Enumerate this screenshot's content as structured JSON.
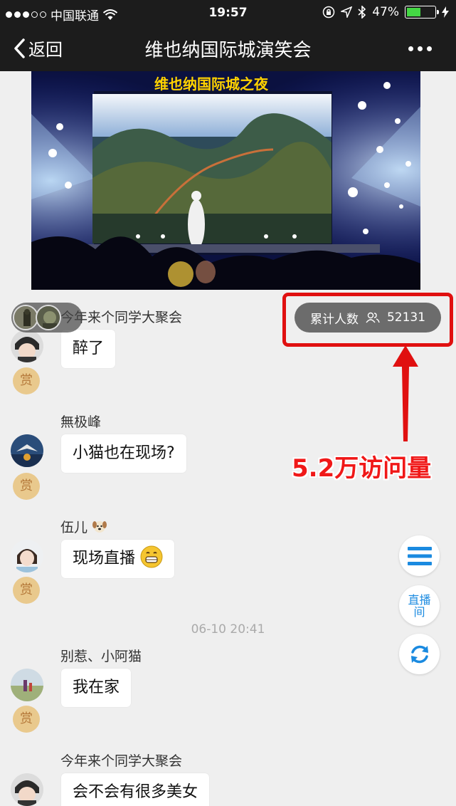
{
  "status_bar": {
    "carrier": "中国联通",
    "time": "19:57",
    "battery_percent": "47%",
    "battery_level": 0.47,
    "signal_bars_filled": 3,
    "signal_bars_total": 5
  },
  "nav": {
    "back_label": "返回",
    "title": "维也纳国际城演笑会"
  },
  "live": {
    "screen_banner": "维也纳国际城之夜",
    "counter_label": "累计人数",
    "counter_value": "52131"
  },
  "annotation": {
    "text": "5.2万访问量"
  },
  "messages": [
    {
      "name": "今年来个同学大聚会",
      "text": "醉了",
      "reward": "赏"
    },
    {
      "name": "無极峰",
      "text": "小猫也在现场?",
      "reward": "赏"
    },
    {
      "name": "伍儿",
      "text": "现场直播",
      "reward": "赏"
    },
    {
      "name": "别惹、小阿猫",
      "text": "我在家",
      "reward": "赏"
    },
    {
      "name": "今年来个同学大聚会",
      "text": "会不会有很多美女"
    }
  ],
  "timestamp": "06-10 20:41",
  "side_buttons": {
    "live_room_line1": "直播",
    "live_room_line2": "间"
  },
  "colors": {
    "annotation_red": "#e01010",
    "accent_blue": "#1a8ae0",
    "reward_gold": "#e9c98d",
    "bar_dark": "#1c1c1c"
  }
}
